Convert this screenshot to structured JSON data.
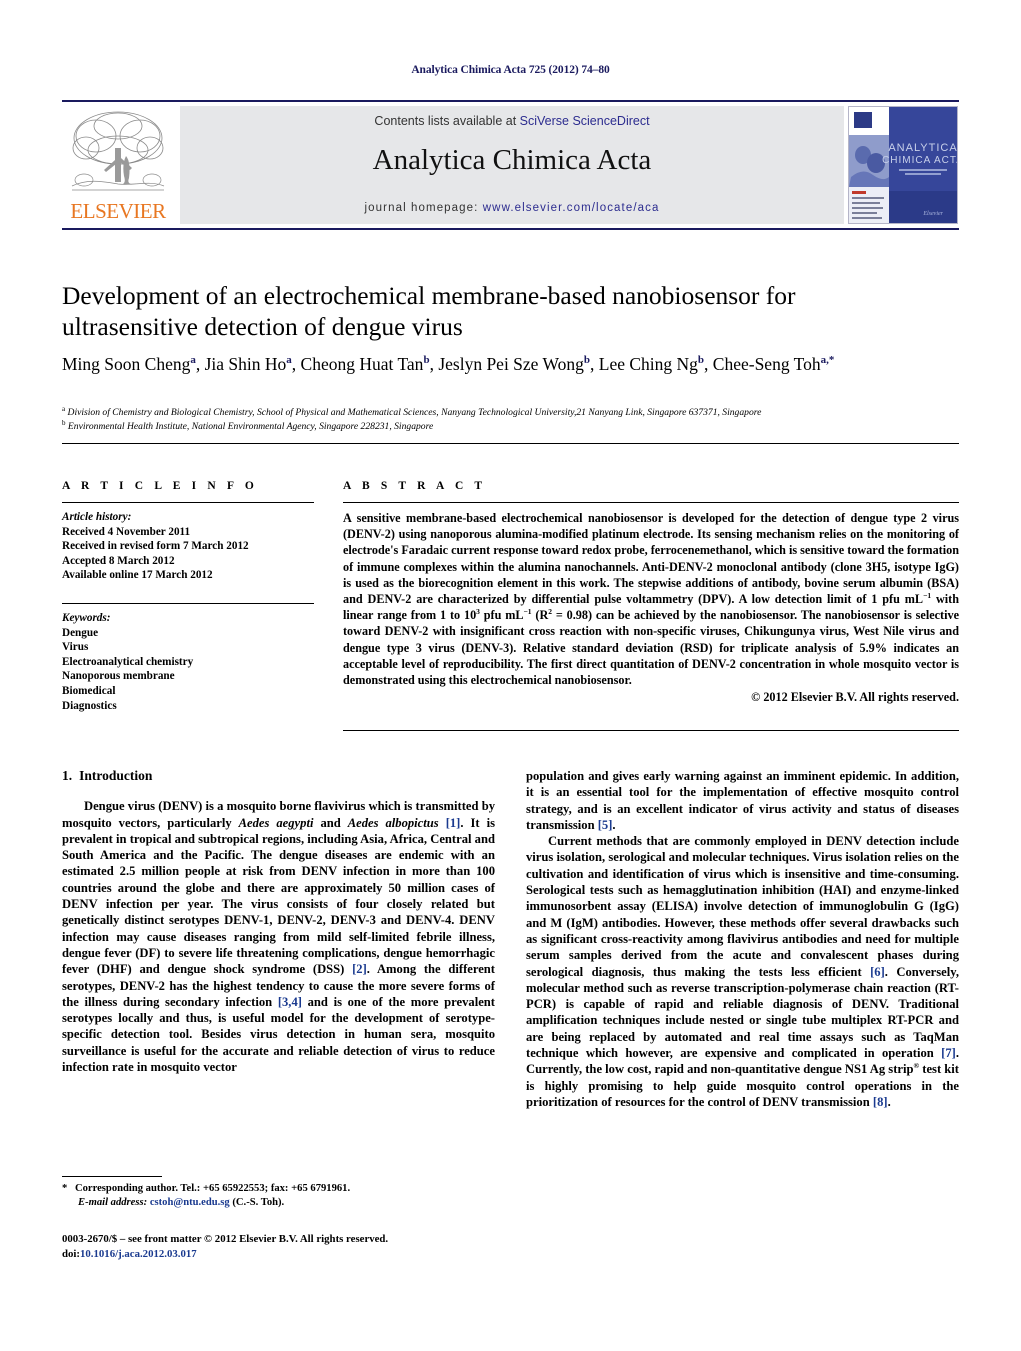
{
  "running_head": "Analytica Chimica Acta 725 (2012) 74–80",
  "masthead": {
    "contents_prefix": "Contents lists available at ",
    "sciencedirect": "SciVerse ScienceDirect",
    "journal_title": "Analytica Chimica Acta",
    "homepage_label": "journal homepage: ",
    "homepage_url": "www.elsevier.com/locate/aca",
    "publisher_name": "ELSEVIER",
    "cover_title_line1": "ANALYTICA",
    "cover_title_line2": "CHIMICA ACTA"
  },
  "article": {
    "title": "Development of an electrochemical membrane-based nanobiosensor for ultrasensitive detection of dengue virus",
    "authors_html": "Ming Soon Cheng<sup>a</sup>, Jia Shin Ho<sup>a</sup>, Cheong Huat Tan<sup>b</sup>, Jeslyn Pei Sze Wong<sup>b</sup>, Lee Ching Ng<sup>b</sup>, Chee-Seng Toh<sup>a,<span>&#42;</span></sup>",
    "affiliation_a": "Division of Chemistry and Biological Chemistry, School of Physical and Mathematical Sciences, Nanyang Technological University,21 Nanyang Link, Singapore 637371, Singapore",
    "affiliation_b": "Environmental Health Institute, National Environmental Agency, Singapore 228231, Singapore"
  },
  "article_info": {
    "heading": "A R T I C L E   I N F O",
    "history_label": "Article history:",
    "history": [
      "Received 4 November 2011",
      "Received in revised form 7 March 2012",
      "Accepted 8 March 2012",
      "Available online 17 March 2012"
    ],
    "keywords_label": "Keywords:",
    "keywords": [
      "Dengue",
      "Virus",
      "Electroanalytical chemistry",
      "Nanoporous membrane",
      "Biomedical",
      "Diagnostics"
    ]
  },
  "abstract": {
    "heading": "A B S T R A C T",
    "text_html": "A sensitive membrane-based electrochemical nanobiosensor is developed for the detection of dengue type 2 virus (DENV-2) using nanoporous alumina-modified platinum electrode. Its sensing mechanism relies on the monitoring of electrode's Faradaic current response toward redox probe, ferrocenemethanol, which is sensitive toward the formation of immune complexes within the alumina nanochannels. Anti-DENV-2 monoclonal antibody (clone 3H5, isotype IgG) is used as the biorecognition element in this work. The stepwise additions of antibody, bovine serum albumin (BSA) and DENV-2 are characterized by differential pulse voltammetry (DPV). A low detection limit of 1 pfu mL<sup class=\"small\">&#8722;1</sup> with linear range from 1 to 10<sup class=\"small\">3</sup> pfu mL<sup class=\"small\">&#8722;1</sup> (R<sup class=\"small\">2</sup> = 0.98) can be achieved by the nanobiosensor. The nanobiosensor is selective toward DENV-2 with insignificant cross reaction with non-specific viruses, Chikungunya virus, West Nile virus and dengue type 3 virus (DENV-3). Relative standard deviation (RSD) for triplicate analysis of 5.9% indicates an acceptable level of reproducibility. The first direct quantitation of DENV-2 concentration in whole mosquito vector is demonstrated using this electrochemical nanobiosensor.",
    "copyright": "© 2012 Elsevier B.V. All rights reserved."
  },
  "body": {
    "section_number": "1.",
    "section_title": "Introduction",
    "left_paragraph_1_html": "Dengue virus (DENV) is a mosquito borne flavivirus which is transmitted by mosquito vectors, particularly <i class=\"sci\">Aedes aegypti</i> and <i class=\"sci\">Aedes albopictus</i> <span class=\"ref\">[1]</span>. It is prevalent in tropical and subtropical regions, including Asia, Africa, Central and South America and the Pacific. The dengue diseases are endemic with an estimated 2.5 million people at risk from DENV infection in more than 100 countries around the globe and there are approximately 50 million cases of DENV infection per year. The virus consists of four closely related but genetically distinct serotypes DENV-1, DENV-2, DENV-3 and DENV-4. DENV infection may cause diseases ranging from mild self-limited febrile illness, dengue fever (DF) to severe life threatening complications, dengue hemorrhagic fever (DHF) and dengue shock syndrome (DSS) <span class=\"ref\">[2]</span>. Among the different serotypes, DENV-2 has the highest tendency to cause the more severe forms of the illness during secondary infection <span class=\"ref\">[3,4]</span> and is one of the more prevalent serotypes locally and thus, is useful model for the development of serotype-specific detection tool. Besides virus detection in human sera, mosquito surveillance is useful for the accurate and reliable detection of virus to reduce infection rate in mosquito vector",
    "right_paragraph_continued_html": "population and gives early warning against an imminent epidemic. In addition, it is an essential tool for the implementation of effective mosquito control strategy, and is an excellent indicator of virus activity and status of diseases transmission <span class=\"ref\">[5]</span>.",
    "right_paragraph_2_html": "Current methods that are commonly employed in DENV detection include virus isolation, serological and molecular techniques. Virus isolation relies on the cultivation and identification of virus which is insensitive and time-consuming. Serological tests such as hemagglutination inhibition (HAI) and enzyme-linked immunosorbent assay (ELISA) involve detection of immunoglobulin G (IgG) and M (IgM) antibodies. However, these methods offer several drawbacks such as significant cross-reactivity among flavivirus antibodies and need for multiple serum samples derived from the acute and convalescent phases during serological diagnosis, thus making the tests less efficient <span class=\"ref\">[6]</span>. Conversely, molecular method such as reverse transcription-polymerase chain reaction (RT-PCR) is capable of rapid and reliable diagnosis of DENV. Traditional amplification techniques include nested or single tube multiplex RT-PCR and are being replaced by automated and real time assays such as TaqMan technique which however, are expensive and complicated in operation <span class=\"ref\">[7]</span>. Currently, the low cost, rapid and non-quantitative dengue NS1 Ag strip<sup class=\"small\">&#174;</sup> test kit is highly promising to help guide mosquito control operations in the prioritization of resources for the control of DENV transmission <span class=\"ref\">[8]</span>."
  },
  "footnotes": {
    "corresponding_html": "<span class=\"star\">&#42;</span> Corresponding author. Tel.: +65 65922553; fax: +65 6791961.",
    "email_html": "<span class=\"em-lbl\">E-mail address:</span> <span class=\"lnk\">cstoh@ntu.edu.sg</span> (C.-S. Toh).",
    "imprint_html": "0003-2670/$ &#8211; see front matter &#169; 2012 Elsevier B.V. All rights reserved.",
    "doi_html": "doi:<span class=\"doi\">10.1016/j.aca.2012.03.017</span>"
  },
  "colors": {
    "link_blue": "#2c2c8f",
    "ref_blue": "#1a3a8f",
    "elsevier_orange": "#E87722",
    "banner_gray": "#e6e7e9",
    "rule_navy": "#1a1a5e"
  }
}
